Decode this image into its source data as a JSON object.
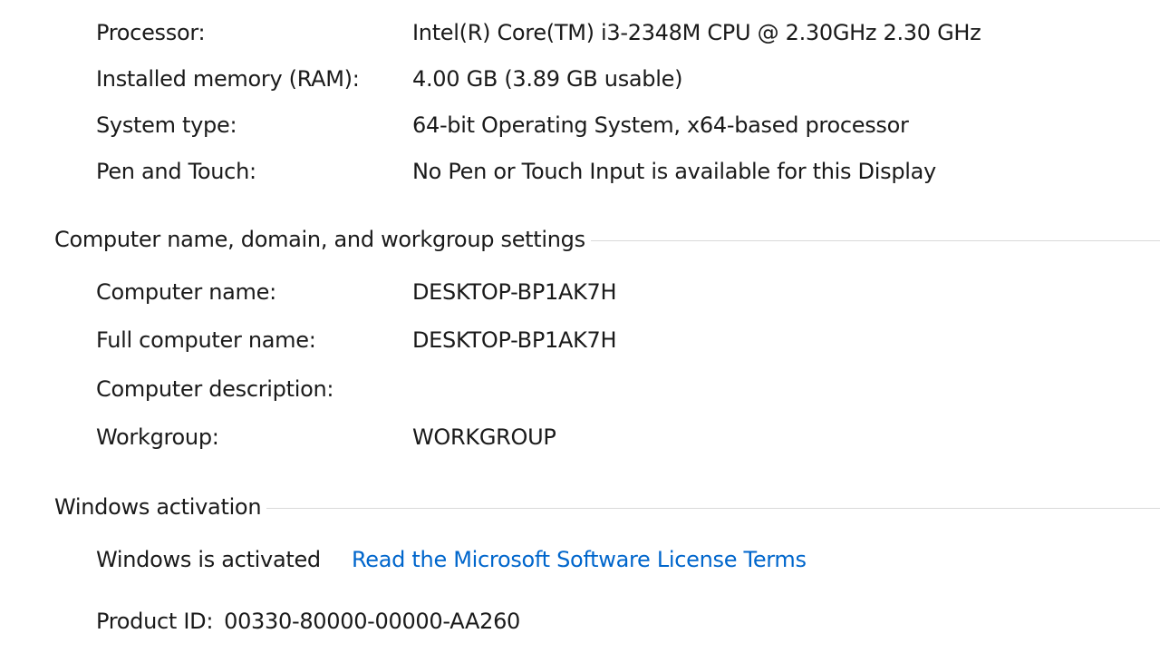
{
  "system": {
    "rows": [
      {
        "label": "Processor:",
        "value": "Intel(R) Core(TM) i3-2348M CPU @ 2.30GHz   2.30 GHz"
      },
      {
        "label": "Installed memory (RAM):",
        "value": "4.00 GB (3.89 GB usable)"
      },
      {
        "label": "System type:",
        "value": "64-bit Operating System, x64-based processor"
      },
      {
        "label": "Pen and Touch:",
        "value": "No Pen or Touch Input is available for this Display"
      }
    ]
  },
  "computer_name": {
    "title": "Computer name, domain, and workgroup settings",
    "rows": [
      {
        "label": "Computer name:",
        "value": "DESKTOP-BP1AK7H"
      },
      {
        "label": "Full computer name:",
        "value": "DESKTOP-BP1AK7H"
      },
      {
        "label": "Computer description:",
        "value": ""
      },
      {
        "label": "Workgroup:",
        "value": "WORKGROUP"
      }
    ]
  },
  "activation": {
    "title": "Windows activation",
    "status": "Windows is activated",
    "license_link": "Read the Microsoft Software License Terms",
    "product_id_label": "Product ID:",
    "product_id_value": "00330-80000-00000-AA260"
  },
  "colors": {
    "link": "#0066cc",
    "rule": "#d9d9d9",
    "text": "#1a1a1a"
  }
}
